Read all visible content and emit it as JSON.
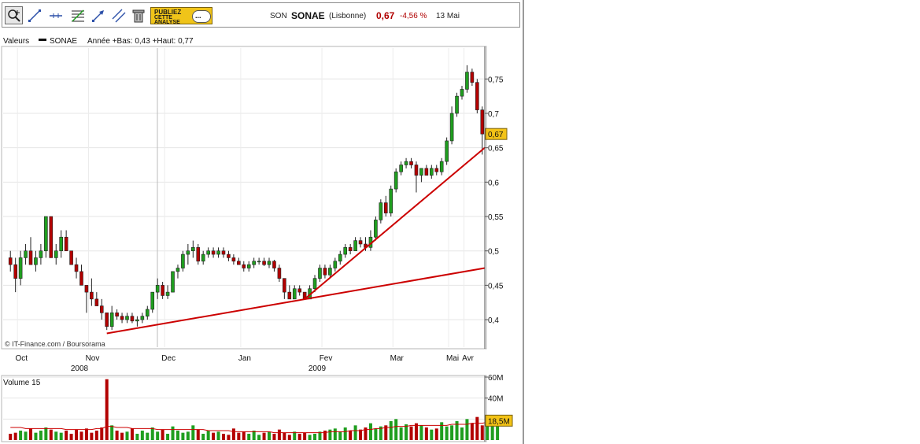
{
  "toolbar": {
    "tools": [
      "zoom-icon",
      "draw-line-icon",
      "horizontal-line-icon",
      "fibonacci-icon",
      "trend-arrow-icon",
      "parallel-lines-icon",
      "trash-icon"
    ],
    "ad_line1": "PUBLIEZ",
    "ad_line2": "CETTE",
    "ad_line3": "ANALYSE",
    "ad_bubble": "..."
  },
  "quote": {
    "symbol": "SON",
    "name": "SONAE",
    "market": "(Lisbonne)",
    "price": "0,67",
    "change": "-4,56 %",
    "date": "13 Mai",
    "price_color": "#b00000"
  },
  "chart_data": [
    {
      "type": "candlestick",
      "legend_prefix": "Valeurs",
      "series_name": "SONAE",
      "legend_info": "Année +Bas: 0,43 +Haut: 0,77",
      "watermark": "© IT-Finance.com / Boursorama",
      "ylim": [
        0.36,
        0.795
      ],
      "yticks": [
        {
          "v": 0.4,
          "l": "0,4"
        },
        {
          "v": 0.45,
          "l": "0,45"
        },
        {
          "v": 0.5,
          "l": "0,5"
        },
        {
          "v": 0.55,
          "l": "0,55"
        },
        {
          "v": 0.6,
          "l": "0,6"
        },
        {
          "v": 0.65,
          "l": "0,65"
        },
        {
          "v": 0.7,
          "l": "0,7"
        },
        {
          "v": 0.75,
          "l": "0,75"
        }
      ],
      "last_price_label": "0,67",
      "last_price": 0.67,
      "xticks": [
        "Oct",
        "Nov",
        "Dec",
        "Jan",
        "Fev",
        "Mar",
        "Avr",
        "Mai"
      ],
      "years": [
        "2008",
        "2009"
      ],
      "up_color": "#1f9e1f",
      "down_color": "#b30000",
      "trendline_color": "#cc0000",
      "trendlines": [
        {
          "from": [
            0.0,
            0.38
          ],
          "to": [
            1.0,
            0.475
          ]
        },
        {
          "from": [
            0.0,
            0.43
          ],
          "to": [
            1.0,
            0.65
          ]
        }
      ],
      "ohlc": [
        [
          0.49,
          0.5,
          0.47,
          0.48
        ],
        [
          0.48,
          0.49,
          0.44,
          0.46
        ],
        [
          0.46,
          0.5,
          0.45,
          0.49
        ],
        [
          0.49,
          0.51,
          0.48,
          0.5
        ],
        [
          0.5,
          0.52,
          0.48,
          0.48
        ],
        [
          0.48,
          0.5,
          0.47,
          0.49
        ],
        [
          0.49,
          0.51,
          0.48,
          0.5
        ],
        [
          0.5,
          0.55,
          0.49,
          0.55
        ],
        [
          0.55,
          0.55,
          0.49,
          0.49
        ],
        [
          0.49,
          0.51,
          0.48,
          0.5
        ],
        [
          0.5,
          0.53,
          0.49,
          0.52
        ],
        [
          0.52,
          0.53,
          0.5,
          0.5
        ],
        [
          0.5,
          0.5,
          0.48,
          0.48
        ],
        [
          0.48,
          0.49,
          0.46,
          0.47
        ],
        [
          0.47,
          0.48,
          0.45,
          0.45
        ],
        [
          0.45,
          0.45,
          0.41,
          0.44
        ],
        [
          0.44,
          0.46,
          0.42,
          0.43
        ],
        [
          0.43,
          0.44,
          0.42,
          0.42
        ],
        [
          0.42,
          0.43,
          0.4,
          0.41
        ],
        [
          0.41,
          0.41,
          0.385,
          0.39
        ],
        [
          0.39,
          0.42,
          0.385,
          0.41
        ],
        [
          0.41,
          0.415,
          0.4,
          0.405
        ],
        [
          0.405,
          0.41,
          0.395,
          0.4
        ],
        [
          0.4,
          0.41,
          0.395,
          0.405
        ],
        [
          0.405,
          0.41,
          0.395,
          0.398
        ],
        [
          0.398,
          0.405,
          0.39,
          0.4
        ],
        [
          0.4,
          0.41,
          0.395,
          0.405
        ],
        [
          0.405,
          0.42,
          0.4,
          0.415
        ],
        [
          0.415,
          0.44,
          0.41,
          0.44
        ],
        [
          0.44,
          0.46,
          0.43,
          0.45
        ],
        [
          0.45,
          0.455,
          0.43,
          0.435
        ],
        [
          0.435,
          0.45,
          0.43,
          0.44
        ],
        [
          0.44,
          0.47,
          0.44,
          0.47
        ],
        [
          0.47,
          0.48,
          0.46,
          0.475
        ],
        [
          0.475,
          0.5,
          0.47,
          0.495
        ],
        [
          0.495,
          0.51,
          0.48,
          0.5
        ],
        [
          0.5,
          0.515,
          0.49,
          0.505
        ],
        [
          0.505,
          0.51,
          0.48,
          0.485
        ],
        [
          0.485,
          0.5,
          0.48,
          0.495
        ],
        [
          0.495,
          0.505,
          0.49,
          0.5
        ],
        [
          0.5,
          0.505,
          0.49,
          0.495
        ],
        [
          0.495,
          0.505,
          0.49,
          0.5
        ],
        [
          0.5,
          0.505,
          0.49,
          0.495
        ],
        [
          0.495,
          0.5,
          0.485,
          0.49
        ],
        [
          0.49,
          0.495,
          0.48,
          0.485
        ],
        [
          0.485,
          0.49,
          0.48,
          0.48
        ],
        [
          0.48,
          0.485,
          0.47,
          0.475
        ],
        [
          0.475,
          0.485,
          0.47,
          0.48
        ],
        [
          0.48,
          0.49,
          0.475,
          0.485
        ],
        [
          0.485,
          0.49,
          0.48,
          0.485
        ],
        [
          0.485,
          0.49,
          0.478,
          0.48
        ],
        [
          0.48,
          0.49,
          0.475,
          0.485
        ],
        [
          0.485,
          0.487,
          0.47,
          0.475
        ],
        [
          0.475,
          0.48,
          0.455,
          0.46
        ],
        [
          0.46,
          0.46,
          0.43,
          0.44
        ],
        [
          0.44,
          0.45,
          0.43,
          0.43
        ],
        [
          0.43,
          0.45,
          0.43,
          0.445
        ],
        [
          0.445,
          0.45,
          0.435,
          0.44
        ],
        [
          0.44,
          0.44,
          0.43,
          0.43
        ],
        [
          0.43,
          0.45,
          0.43,
          0.445
        ],
        [
          0.445,
          0.465,
          0.44,
          0.46
        ],
        [
          0.46,
          0.48,
          0.455,
          0.475
        ],
        [
          0.475,
          0.48,
          0.46,
          0.465
        ],
        [
          0.465,
          0.48,
          0.46,
          0.475
        ],
        [
          0.475,
          0.49,
          0.47,
          0.485
        ],
        [
          0.485,
          0.5,
          0.48,
          0.495
        ],
        [
          0.495,
          0.51,
          0.49,
          0.505
        ],
        [
          0.505,
          0.51,
          0.495,
          0.5
        ],
        [
          0.5,
          0.52,
          0.5,
          0.515
        ],
        [
          0.515,
          0.52,
          0.505,
          0.51
        ],
        [
          0.51,
          0.52,
          0.5,
          0.505
        ],
        [
          0.505,
          0.53,
          0.5,
          0.52
        ],
        [
          0.52,
          0.55,
          0.515,
          0.545
        ],
        [
          0.545,
          0.575,
          0.54,
          0.57
        ],
        [
          0.57,
          0.58,
          0.55,
          0.555
        ],
        [
          0.555,
          0.595,
          0.55,
          0.59
        ],
        [
          0.59,
          0.62,
          0.585,
          0.615
        ],
        [
          0.615,
          0.63,
          0.61,
          0.625
        ],
        [
          0.625,
          0.635,
          0.62,
          0.63
        ],
        [
          0.63,
          0.635,
          0.62,
          0.625
        ],
        [
          0.625,
          0.63,
          0.585,
          0.61
        ],
        [
          0.61,
          0.62,
          0.6,
          0.62
        ],
        [
          0.62,
          0.625,
          0.61,
          0.61
        ],
        [
          0.61,
          0.625,
          0.605,
          0.62
        ],
        [
          0.62,
          0.625,
          0.61,
          0.615
        ],
        [
          0.615,
          0.635,
          0.61,
          0.63
        ],
        [
          0.63,
          0.665,
          0.625,
          0.66
        ],
        [
          0.66,
          0.71,
          0.655,
          0.7
        ],
        [
          0.7,
          0.73,
          0.695,
          0.725
        ],
        [
          0.725,
          0.74,
          0.72,
          0.735
        ],
        [
          0.735,
          0.77,
          0.73,
          0.76
        ],
        [
          0.76,
          0.765,
          0.74,
          0.745
        ],
        [
          0.745,
          0.75,
          0.7,
          0.705
        ],
        [
          0.705,
          0.71,
          0.64,
          0.67
        ]
      ]
    },
    {
      "type": "bar",
      "title": "Volume 15",
      "ylim": [
        0,
        60
      ],
      "yticks": [
        {
          "v": 20,
          "l": "20M"
        },
        {
          "v": 40,
          "l": "40M"
        },
        {
          "v": 60,
          "l": "60M"
        }
      ],
      "last_label": "18,5M",
      "last_value": 18.5,
      "moving_average_color": "#cc0000",
      "values": [
        6,
        7,
        9,
        8,
        11,
        7,
        9,
        12,
        10,
        8,
        7,
        9,
        6,
        10,
        8,
        11,
        7,
        9,
        12,
        58,
        14,
        9,
        7,
        8,
        11,
        6,
        9,
        7,
        12,
        8,
        10,
        6,
        13,
        9,
        7,
        8,
        14,
        10,
        6,
        9,
        7,
        8,
        6,
        5,
        11,
        7,
        8,
        6,
        9,
        5,
        7,
        8,
        6,
        10,
        7,
        5,
        8,
        6,
        7,
        5,
        6,
        8,
        9,
        10,
        11,
        8,
        12,
        9,
        14,
        10,
        12,
        16,
        11,
        13,
        14,
        18,
        20,
        12,
        15,
        13,
        16,
        14,
        12,
        10,
        11,
        17,
        13,
        14,
        18,
        12,
        20,
        16,
        22,
        14,
        18,
        20,
        19
      ],
      "moving_average": [
        12,
        12,
        12,
        11,
        11,
        11,
        11,
        11,
        11,
        11,
        11,
        10,
        10,
        10,
        10,
        10,
        10,
        11,
        11,
        13,
        13,
        12,
        12,
        12,
        11,
        11,
        11,
        11,
        11,
        10,
        10,
        10,
        10,
        10,
        10,
        10,
        10,
        10,
        10,
        9,
        9,
        9,
        9,
        9,
        8,
        8,
        8,
        8,
        8,
        8,
        8,
        8,
        7,
        7,
        7,
        7,
        7,
        7,
        7,
        7,
        7,
        7,
        7,
        8,
        8,
        8,
        8,
        9,
        9,
        9,
        10,
        10,
        11,
        11,
        12,
        12,
        13,
        13,
        13,
        14,
        14,
        14,
        14,
        14,
        14,
        14,
        14,
        15,
        15,
        15,
        15,
        16,
        16,
        16,
        17,
        17,
        17
      ]
    }
  ]
}
